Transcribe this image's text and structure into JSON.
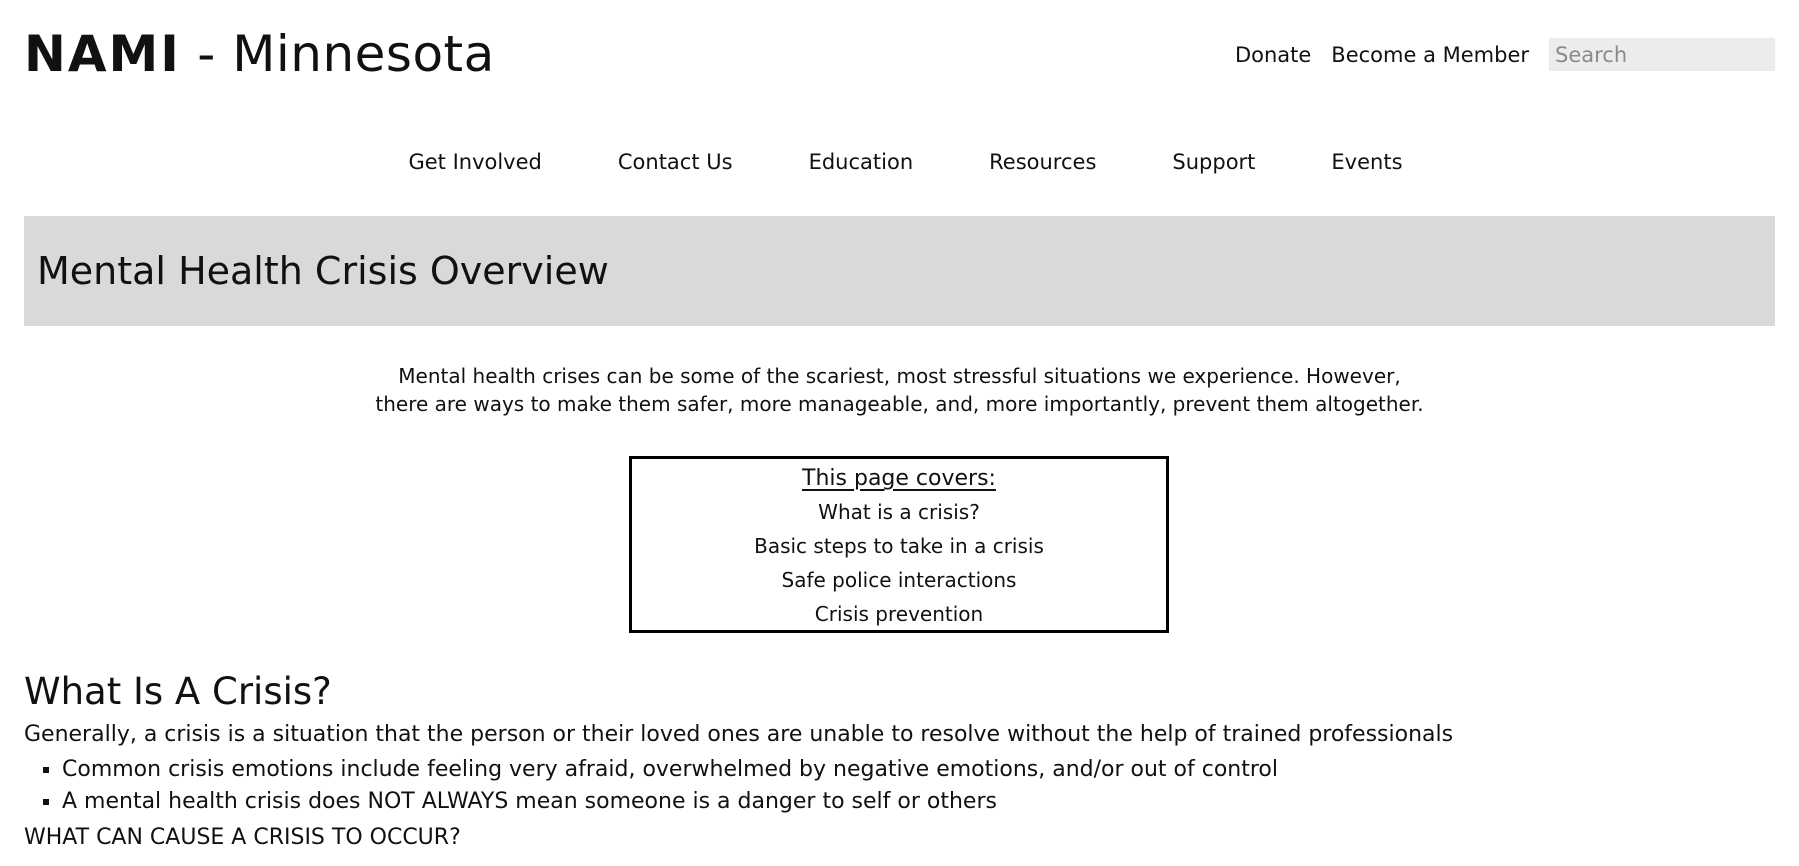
{
  "header": {
    "brand": "NAMI",
    "title_rest": " - Minnesota",
    "utility_links": [
      "Donate",
      "Become a Member"
    ],
    "search_placeholder": "Search"
  },
  "nav": {
    "items": [
      "Get Involved",
      "Contact Us",
      "Education",
      "Resources",
      "Support",
      "Events"
    ]
  },
  "banner": {
    "title": "Mental Health Crisis Overview"
  },
  "intro": {
    "line1": "Mental health crises can be some of the scariest, most stressful situations we experience. However,",
    "line2": "there are ways to make them safer, more manageable, and, more importantly, prevent them altogether."
  },
  "toc": {
    "title": "This page covers:",
    "items": [
      "What is a crisis?",
      "Basic steps to take in a crisis",
      "Safe police interactions",
      "Crisis prevention"
    ]
  },
  "section": {
    "heading": "What Is A Crisis?",
    "lead": "Generally, a crisis is a situation that the person or their loved ones are unable to resolve without the help of trained professionals",
    "bullets": [
      "Common crisis emotions include feeling very afraid, overwhelmed by negative emotions, and/or out of control",
      "A mental health crisis does NOT ALWAYS mean someone is a danger to self or others"
    ],
    "subheading": "WHAT CAN CAUSE A CRISIS TO OCCUR?"
  }
}
